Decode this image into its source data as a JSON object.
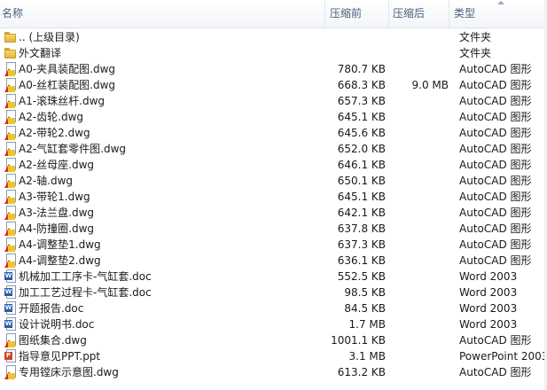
{
  "columns": {
    "name": "名称",
    "compressed_size": "压缩前",
    "original_size": "压缩后",
    "type": "类型"
  },
  "files": [
    {
      "name": ".. (上级目录)",
      "size": "",
      "packed": "",
      "type": "文件夹",
      "icon": "folder-icon"
    },
    {
      "name": "外文翻译",
      "size": "",
      "packed": "",
      "type": "文件夹",
      "icon": "folder-icon"
    },
    {
      "name": "A0-夹具装配图.dwg",
      "size": "780.7 KB",
      "packed": "",
      "type": "AutoCAD 图形",
      "icon": "autocad-drawing-icon"
    },
    {
      "name": "A0-丝杠装配图.dwg",
      "size": "668.3 KB",
      "packed": "9.0 MB",
      "type": "AutoCAD 图形",
      "icon": "autocad-drawing-icon"
    },
    {
      "name": "A1-滚珠丝杆.dwg",
      "size": "657.3 KB",
      "packed": "",
      "type": "AutoCAD 图形",
      "icon": "autocad-drawing-icon"
    },
    {
      "name": "A2-齿轮.dwg",
      "size": "645.1 KB",
      "packed": "",
      "type": "AutoCAD 图形",
      "icon": "autocad-drawing-icon"
    },
    {
      "name": "A2-带轮2.dwg",
      "size": "645.6 KB",
      "packed": "",
      "type": "AutoCAD 图形",
      "icon": "autocad-drawing-icon"
    },
    {
      "name": "A2-气缸套零件图.dwg",
      "size": "652.0 KB",
      "packed": "",
      "type": "AutoCAD 图形",
      "icon": "autocad-drawing-icon"
    },
    {
      "name": "A2-丝母座.dwg",
      "size": "646.1 KB",
      "packed": "",
      "type": "AutoCAD 图形",
      "icon": "autocad-drawing-icon"
    },
    {
      "name": "A2-轴.dwg",
      "size": "650.1 KB",
      "packed": "",
      "type": "AutoCAD 图形",
      "icon": "autocad-drawing-icon"
    },
    {
      "name": "A3-带轮1.dwg",
      "size": "645.1 KB",
      "packed": "",
      "type": "AutoCAD 图形",
      "icon": "autocad-drawing-icon"
    },
    {
      "name": "A3-法兰盘.dwg",
      "size": "642.1 KB",
      "packed": "",
      "type": "AutoCAD 图形",
      "icon": "autocad-drawing-icon"
    },
    {
      "name": "A4-防撞圈.dwg",
      "size": "637.8 KB",
      "packed": "",
      "type": "AutoCAD 图形",
      "icon": "autocad-drawing-icon"
    },
    {
      "name": "A4-调整垫1.dwg",
      "size": "637.3 KB",
      "packed": "",
      "type": "AutoCAD 图形",
      "icon": "autocad-drawing-icon"
    },
    {
      "name": "A4-调整垫2.dwg",
      "size": "636.1 KB",
      "packed": "",
      "type": "AutoCAD 图形",
      "icon": "autocad-drawing-icon"
    },
    {
      "name": "机械加工工序卡-气缸套.doc",
      "size": "552.5 KB",
      "packed": "",
      "type": "Word 2003",
      "icon": "word-document-icon"
    },
    {
      "name": "加工工艺过程卡-气缸套.doc",
      "size": "98.5 KB",
      "packed": "",
      "type": "Word 2003",
      "icon": "word-document-icon"
    },
    {
      "name": "开题报告.doc",
      "size": "84.5 KB",
      "packed": "",
      "type": "Word 2003",
      "icon": "word-document-icon"
    },
    {
      "name": "设计说明书.doc",
      "size": "1.7 MB",
      "packed": "",
      "type": "Word 2003",
      "icon": "word-document-icon"
    },
    {
      "name": "图纸集合.dwg",
      "size": "1001.1 KB",
      "packed": "",
      "type": "AutoCAD 图形",
      "icon": "autocad-drawing-icon"
    },
    {
      "name": "指导意见PPT.ppt",
      "size": "3.1 MB",
      "packed": "",
      "type": "PowerPoint 2003",
      "icon": "powerpoint-icon"
    },
    {
      "name": "专用镗床示意图.dwg",
      "size": "613.2 KB",
      "packed": "",
      "type": "AutoCAD 图形",
      "icon": "autocad-drawing-icon"
    }
  ]
}
